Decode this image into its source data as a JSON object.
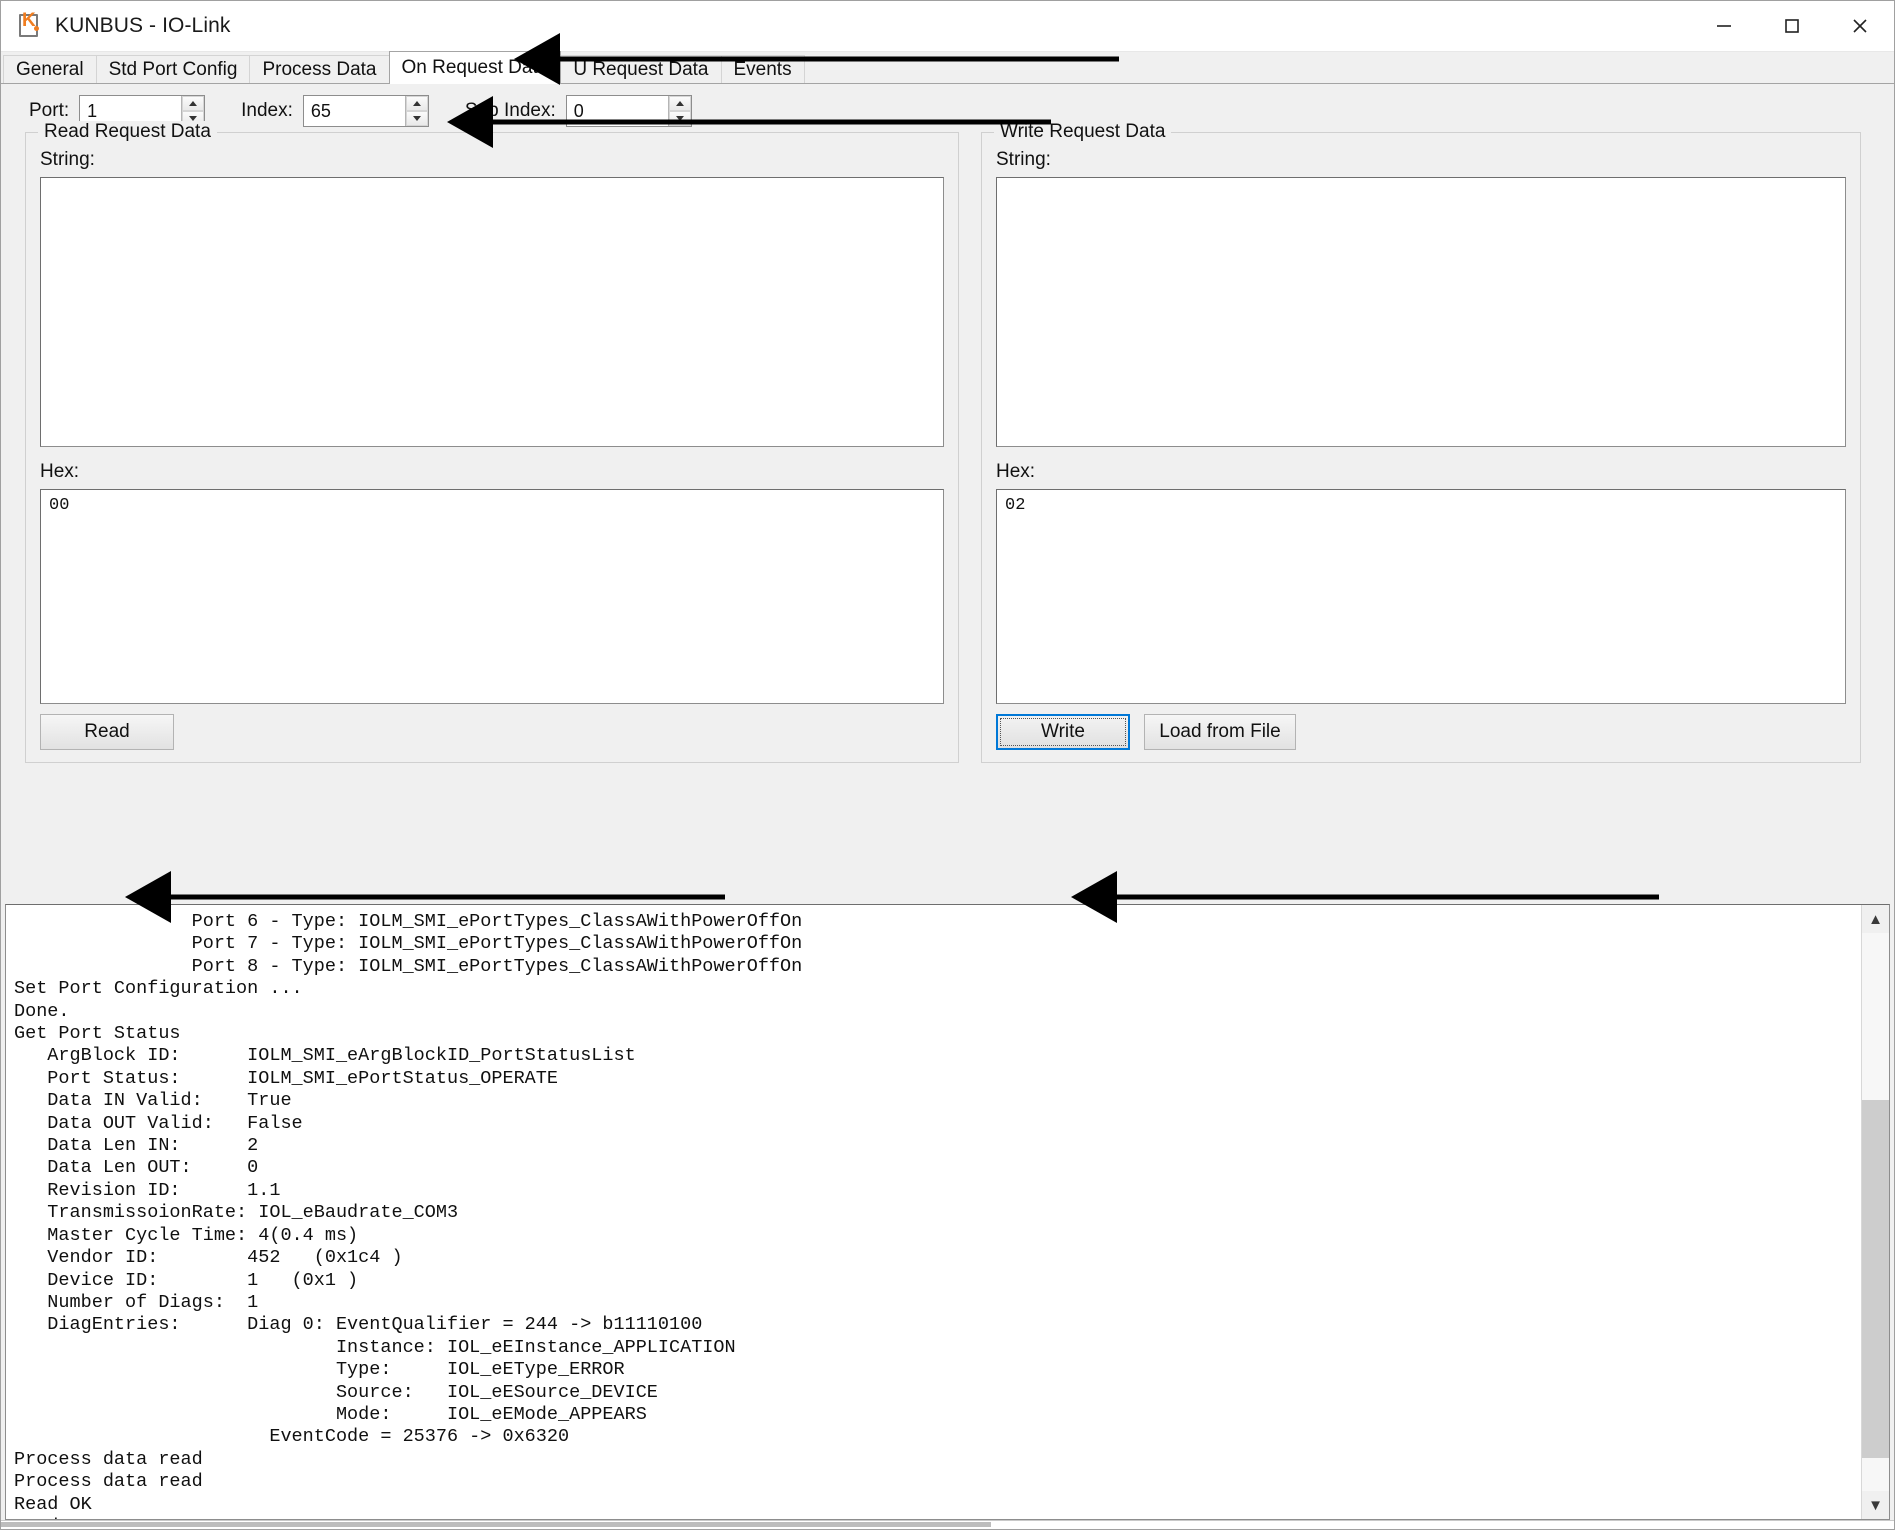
{
  "window": {
    "title": "KUNBUS - IO-Link",
    "icon": "kunbus-k-icon",
    "controls": {
      "minimize": "minimize-icon",
      "maximize": "maximize-icon",
      "close": "close-icon"
    }
  },
  "tabs": [
    {
      "label": "General",
      "active": false
    },
    {
      "label": "Std Port Config",
      "active": false
    },
    {
      "label": "Process Data",
      "active": false
    },
    {
      "label": "On Request Data",
      "active": true
    },
    {
      "label": "U Request Data",
      "active": false
    },
    {
      "label": "Events",
      "active": false
    }
  ],
  "params": [
    {
      "label": "Port:",
      "value": "1"
    },
    {
      "label": "Index:",
      "value": "65"
    },
    {
      "label": "Sub Index:",
      "value": "0"
    }
  ],
  "read_panel": {
    "title": "Read Request Data",
    "string_label": "String:",
    "string_value": "",
    "hex_label": "Hex:",
    "hex_value": "00",
    "read_button": "Read"
  },
  "write_panel": {
    "title": "Write Request Data",
    "string_label": "String:",
    "string_value": "",
    "hex_label": "Hex:",
    "hex_value": "02",
    "write_button": "Write",
    "load_button": "Load from File"
  },
  "console": {
    "text": "                Port 6 - Type: IOLM_SMI_ePortTypes_ClassAWithPowerOffOn\n                Port 7 - Type: IOLM_SMI_ePortTypes_ClassAWithPowerOffOn\n                Port 8 - Type: IOLM_SMI_ePortTypes_ClassAWithPowerOffOn\nSet Port Configuration ...\nDone.\nGet Port Status\n   ArgBlock ID:      IOLM_SMI_eArgBlockID_PortStatusList\n   Port Status:      IOLM_SMI_ePortStatus_OPERATE\n   Data IN Valid:    True\n   Data OUT Valid:   False\n   Data Len IN:      2\n   Data Len OUT:     0\n   Revision ID:      1.1\n   TransmissoionRate: IOL_eBaudrate_COM3\n   Master Cycle Time: 4(0.4 ms)\n   Vendor ID:        452   (0x1c4 )\n   Device ID:        1   (0x1 )\n   Number of Diags:  1\n   DiagEntries:      Diag 0: EventQualifier = 244 -> b11110100\n                             Instance: IOL_eEInstance_APPLICATION\n                             Type:     IOL_eEType_ERROR\n                             Source:   IOL_eESource_DEVICE\n                             Mode:     IOL_eEMode_APPEARS\n                       EventCode = 25376 -> 0x6320\nProcess data read\nProcess data read\nRead OK\nRead OK\nWrite OK",
    "scroll_up_icon": "chevron-up-icon",
    "scroll_down_icon": "chevron-down-icon"
  },
  "annotations": [
    {
      "name": "arrow-to-on-request-data-tab"
    },
    {
      "name": "arrow-to-index-field"
    },
    {
      "name": "arrow-to-read-button"
    },
    {
      "name": "arrow-to-write-button"
    }
  ],
  "colors": {
    "accent": "#0078d7",
    "brand": "#f07d20",
    "window_bg": "#f0f0f0",
    "field_bg": "#ffffff"
  }
}
